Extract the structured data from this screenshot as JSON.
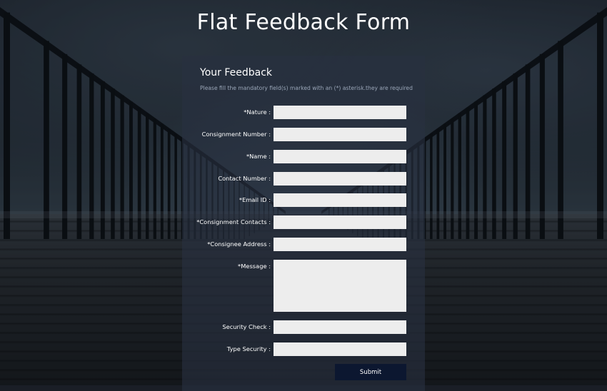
{
  "page": {
    "title": "Flat Feedback Form"
  },
  "form": {
    "heading": "Your Feedback",
    "note": "Please fill the mandatory field(s) marked with an (*) asterisk.they are required",
    "fields": {
      "nature": {
        "label": "*Nature :",
        "value": ""
      },
      "consignment_number": {
        "label": "Consignment Number :",
        "value": ""
      },
      "name": {
        "label": "*Name :",
        "value": ""
      },
      "contact_number": {
        "label": "Contact Number :",
        "value": ""
      },
      "email": {
        "label": "*Email ID :",
        "value": ""
      },
      "consignment_contacts": {
        "label": "*Consignment Contacts :",
        "value": ""
      },
      "consignee_address": {
        "label": "*Consignee Address :",
        "value": ""
      },
      "message": {
        "label": "*Message :",
        "value": ""
      },
      "security_check": {
        "label": "Security Check :",
        "value": ""
      },
      "type_security": {
        "label": "Type Security :",
        "value": ""
      }
    },
    "submit_label": "Submit"
  },
  "colors": {
    "panel_bg": "#283040",
    "input_bg": "#ededed",
    "button_bg": "#0c1730",
    "note_text": "#9aa6b8"
  }
}
